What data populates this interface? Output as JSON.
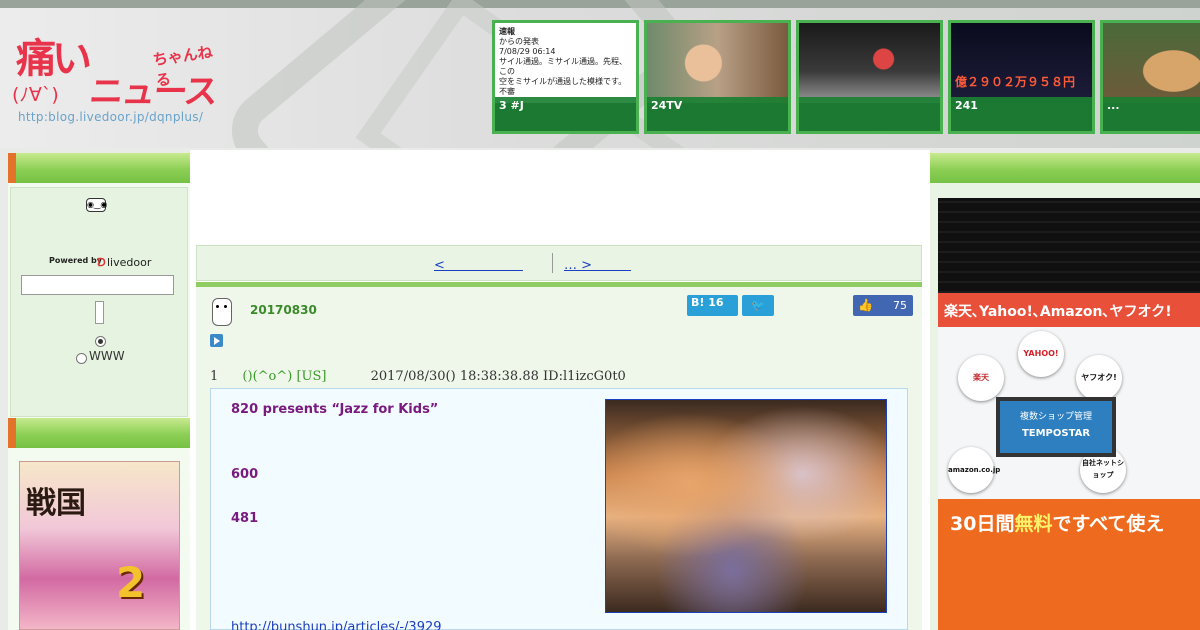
{
  "header": {
    "logo": {
      "kanji": "痛い",
      "chan": "ちゃんねる",
      "face": "(ﾉ∀`)",
      "news": "ニュース",
      "url": "http:blog.livedoor.jp/dqnplus/"
    },
    "thumbnails": [
      {
        "caption": "3 #J",
        "text_lines": [
          "速報",
          "からの発表",
          "7/08/29 06:14",
          "サイル通過。ミサイル通過。先程、この",
          "空をミサイルが通過した模様です。不審"
        ]
      },
      {
        "caption": "24TV"
      },
      {
        "caption": ""
      },
      {
        "caption": "241",
        "overlay": "億２９０２万９５８円"
      },
      {
        "caption": "..."
      }
    ]
  },
  "left_sidebar": {
    "powered_by": "Powered by",
    "livedoor": "livedoor",
    "search_placeholder": "",
    "radio_www": "WWW",
    "ad_title": "戦国",
    "ad_number": "2"
  },
  "center": {
    "nav": {
      "prev": "<　　　　　　",
      "next": "… >　　　"
    },
    "post": {
      "date": "20170830",
      "hatena_count": "B! 16",
      "twitter_label": "🐦",
      "fb_count": "75",
      "res_number": "1",
      "res_name": "()(^o^) [US]",
      "res_meta": "2017/08/30() 18:38:38.88 ID:l1izcG0t0",
      "body_lines": [
        "820 presents “Jazz for Kids”",
        "600",
        "481"
      ],
      "link": "http://bunshun.jp/articles/-/3929"
    }
  },
  "right_sidebar": {
    "ad": {
      "tagline": "楽天､Yahoo!､Amazon､ヤフオク!",
      "bubbles": [
        "楽天",
        "YAHOO!",
        "ヤフオク!",
        "amazon.co.jp",
        "自社ネットショップ"
      ],
      "screen_title": "複数ショップ管理",
      "screen_brand": "TEMPOSTAR",
      "bottom_pre": "30日間",
      "bottom_highlight": "無料",
      "bottom_post": "ですべて使え"
    }
  },
  "colors": {
    "sidebar_green": "#8ccf55",
    "accent_orange": "#e3722a",
    "thumb_caption": "#1a8032",
    "post_text": "#7a1a7e",
    "link_blue": "#1a3fbf"
  }
}
